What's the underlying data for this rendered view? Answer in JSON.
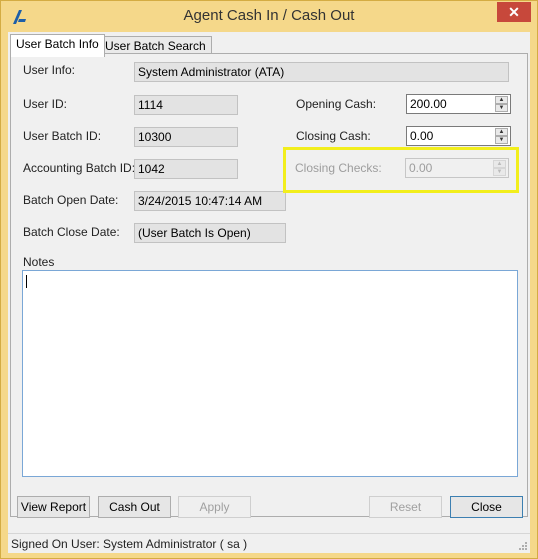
{
  "window": {
    "title": "Agent Cash In / Cash Out",
    "close_glyph": "✕",
    "icon": "app-logo-icon",
    "accent_color": "#f5d88a",
    "highlight_color": "#f2ee1c"
  },
  "tabs": [
    {
      "label": "User Batch Info",
      "active": true
    },
    {
      "label": "User Batch Search",
      "active": false
    }
  ],
  "fields": {
    "user_info": {
      "label": "User Info:",
      "value": "System Administrator (ATA)"
    },
    "user_id": {
      "label": "User ID:",
      "value": "1114"
    },
    "user_batch_id": {
      "label": "User Batch ID:",
      "value": "10300"
    },
    "accounting_batch_id": {
      "label": "Accounting Batch ID:",
      "value": "1042"
    },
    "batch_open_date": {
      "label": "Batch Open Date:",
      "value": "3/24/2015 10:47:14 AM"
    },
    "batch_close_date": {
      "label": "Batch Close Date:",
      "value": "(User Batch Is Open)"
    },
    "opening_cash": {
      "label": "Opening Cash:",
      "value": "200.00"
    },
    "closing_cash": {
      "label": "Closing Cash:",
      "value": "0.00"
    },
    "closing_checks": {
      "label": "Closing Checks:",
      "value": "0.00",
      "enabled": false
    },
    "notes": {
      "label": "Notes",
      "value": ""
    }
  },
  "buttons": {
    "view_report": "View Report",
    "cash_out": "Cash Out",
    "apply": "Apply",
    "reset": "Reset",
    "close": "Close"
  },
  "status_bar": {
    "text": "Signed On User: System Administrator ( sa )"
  }
}
